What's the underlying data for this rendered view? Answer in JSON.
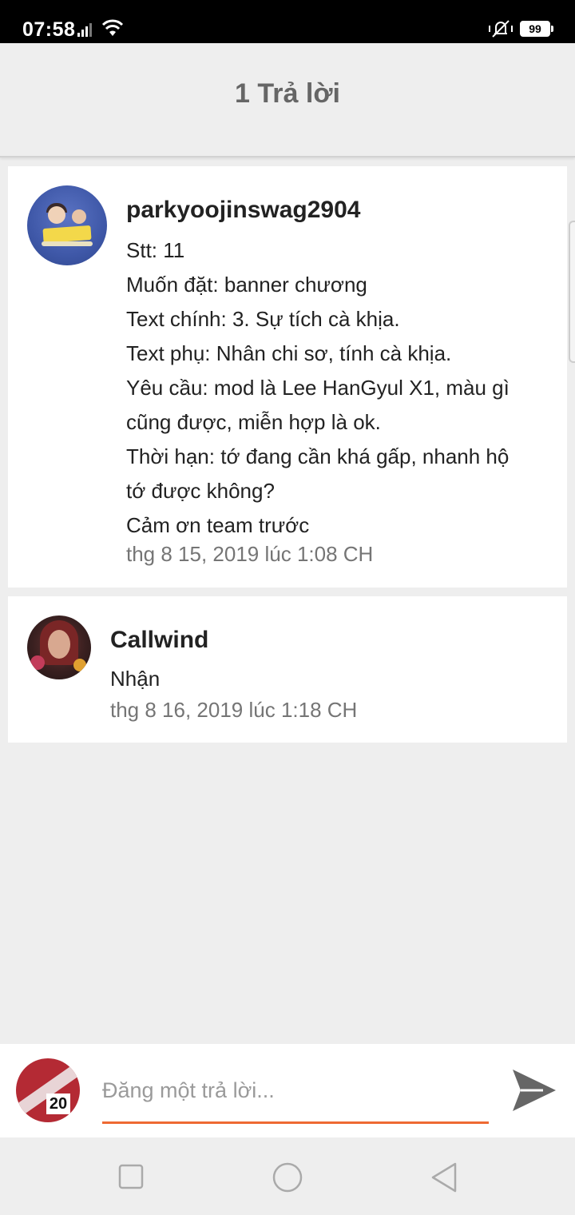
{
  "status_bar": {
    "time": "07:58",
    "battery": "99",
    "icons": [
      "signal-icon",
      "wifi-icon",
      "vibrate-icon",
      "battery-icon"
    ]
  },
  "header": {
    "title": "1 Trả lời"
  },
  "comments": [
    {
      "username": "parkyoojinswag2904",
      "lines": [
        "Stt: 11",
        "Muốn đặt: banner chương",
        "Text chính: 3. Sự tích cà khịa.",
        "Text phụ: Nhân chi sơ, tính cà khịa.",
        "Yêu cầu: mod là Lee HanGyul X1, màu gì",
        "cũng được, miễn hợp là ok.",
        "Thời hạn: tớ đang cần khá gấp, nhanh hộ",
        "tớ được không?",
        "Cảm ơn team trước"
      ],
      "timestamp": "thg 8 15, 2019 lúc 1:08 CH"
    },
    {
      "username": "Callwind",
      "message": "Nhận",
      "timestamp": "thg 8 16, 2019 lúc 1:18 CH"
    }
  ],
  "reply": {
    "placeholder": "Đăng một trả lời...",
    "avatar_badge": "20",
    "accent_color": "#ee6a33"
  },
  "nav": {
    "icons": [
      "recents-icon",
      "home-icon",
      "back-icon"
    ]
  }
}
